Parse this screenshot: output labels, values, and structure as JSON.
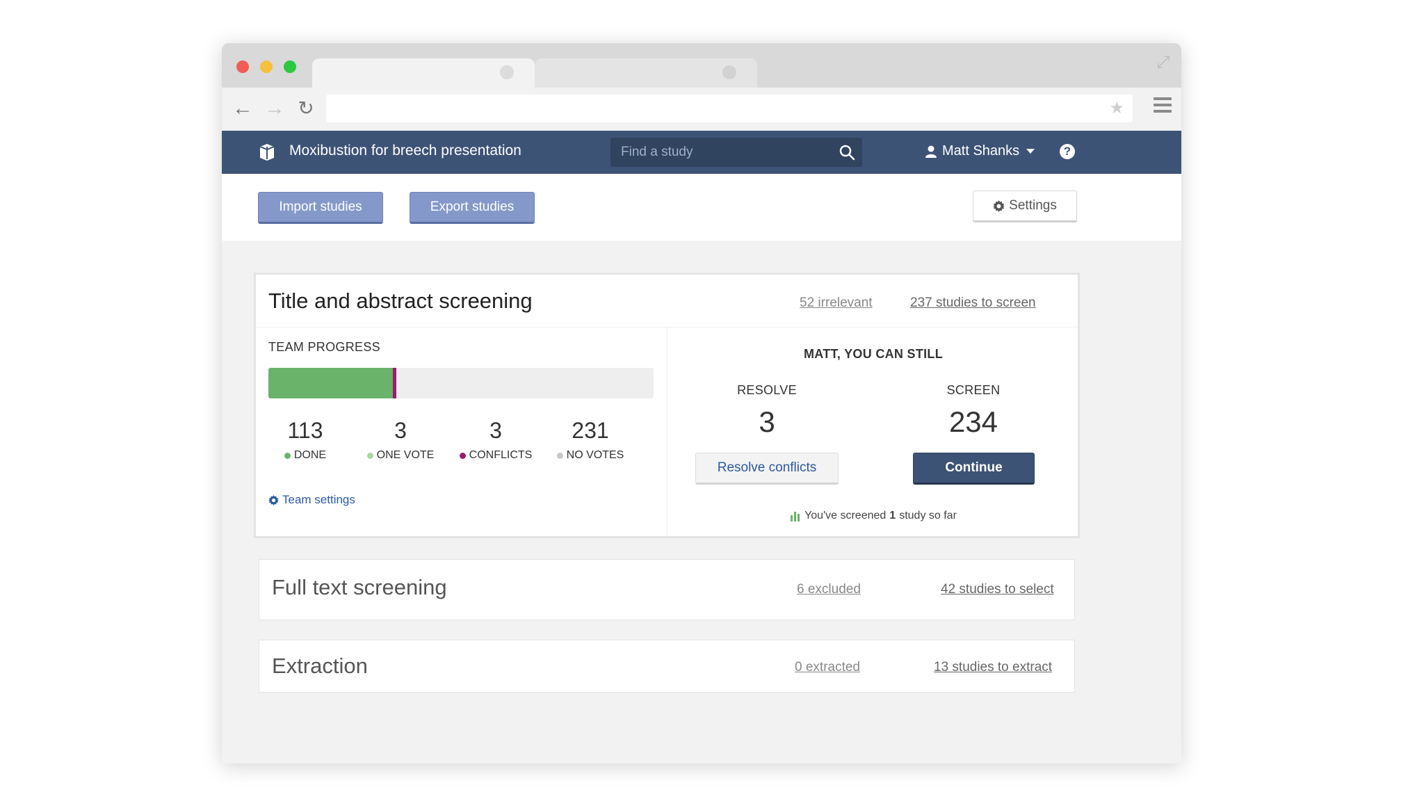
{
  "browser": {
    "tabs": [
      "",
      ""
    ],
    "url": ""
  },
  "app": {
    "title": "Moxibustion for breech presentation",
    "search_placeholder": "Find a study",
    "user_name": "Matt Shanks",
    "help_label": "?"
  },
  "toolbar": {
    "import_label": "Import studies",
    "export_label": "Export studies",
    "settings_label": "Settings"
  },
  "title_abstract": {
    "title": "Title and abstract screening",
    "irrelevant_link": "52 irrelevant",
    "to_screen_link": "237 studies to screen",
    "team_progress_label": "TEAM PROGRESS",
    "progress": {
      "done_fraction": 0.324,
      "conflicts_fraction": 0.009
    },
    "stats": [
      {
        "value": "113",
        "label": "DONE",
        "color": "#6ab36a"
      },
      {
        "value": "3",
        "label": "ONE VOTE",
        "color": "#a9d7a0"
      },
      {
        "value": "3",
        "label": "CONFLICTS",
        "color": "#a0196c"
      },
      {
        "value": "231",
        "label": "NO VOTES",
        "color": "#c8c8c8"
      }
    ],
    "team_settings_label": "Team settings",
    "can_still_label": "MATT, YOU CAN STILL",
    "resolve": {
      "label": "RESOLVE",
      "value": "3",
      "button": "Resolve conflicts"
    },
    "screen": {
      "label": "SCREEN",
      "value": "234",
      "button": "Continue"
    },
    "screened_note": {
      "prefix": "You've screened",
      "count": "1",
      "suffix": "study so far"
    }
  },
  "full_text": {
    "title": "Full text screening",
    "excluded_link": "6 excluded",
    "to_select_link": "42 studies to select"
  },
  "extraction": {
    "title": "Extraction",
    "extracted_link": "0 extracted",
    "to_extract_link": "13 studies to extract"
  },
  "colors": {
    "header_bg": "#3d5376",
    "accent_link": "#2c5aa0",
    "done_green": "#6ab36a",
    "conflict_magenta": "#a0196c"
  }
}
